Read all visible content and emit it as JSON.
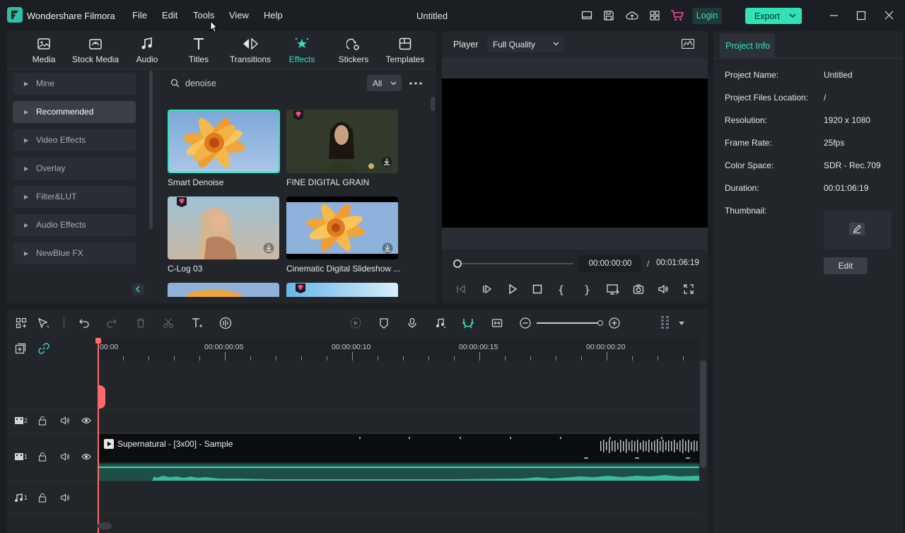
{
  "app": {
    "name": "Wondershare Filmora",
    "doc_title": "Untitled"
  },
  "menu": [
    "File",
    "Edit",
    "Tools",
    "View",
    "Help"
  ],
  "header": {
    "login": "Login",
    "export": "Export"
  },
  "media_tabs": [
    {
      "label": "Media",
      "icon": "media-icon"
    },
    {
      "label": "Stock Media",
      "icon": "stock-media-icon"
    },
    {
      "label": "Audio",
      "icon": "audio-note-icon"
    },
    {
      "label": "Titles",
      "icon": "titles-icon"
    },
    {
      "label": "Transitions",
      "icon": "transitions-icon"
    },
    {
      "label": "Effects",
      "icon": "effects-icon",
      "active": true
    },
    {
      "label": "Stickers",
      "icon": "stickers-icon"
    },
    {
      "label": "Templates",
      "icon": "templates-icon"
    }
  ],
  "categories": [
    {
      "label": "Mine"
    },
    {
      "label": "Recommended",
      "active": true
    },
    {
      "label": "Video Effects"
    },
    {
      "label": "Overlay"
    },
    {
      "label": "Filter&LUT"
    },
    {
      "label": "Audio Effects"
    },
    {
      "label": "NewBlue FX"
    }
  ],
  "search": {
    "value": "denoise",
    "filter": "All"
  },
  "effects": [
    {
      "label": "Smart Denoise",
      "selected": true
    },
    {
      "label": "FINE DIGITAL GRAIN",
      "premium": true
    },
    {
      "label": "C-Log 03",
      "premium": true
    },
    {
      "label": "Cinematic Digital Slideshow ..."
    }
  ],
  "player": {
    "label": "Player",
    "quality": "Full Quality",
    "current_time": "00:00:00:00",
    "separator": "/",
    "total_time": "00:01:06:19"
  },
  "project_info": {
    "tab": "Project Info",
    "rows": [
      {
        "label": "Project Name:",
        "value": "Untitled"
      },
      {
        "label": "Project Files Location:",
        "value": "/"
      },
      {
        "label": "Resolution:",
        "value": "1920 x 1080"
      },
      {
        "label": "Frame Rate:",
        "value": "25fps"
      },
      {
        "label": "Color Space:",
        "value": "SDR - Rec.709"
      },
      {
        "label": "Duration:",
        "value": "00:01:06:19"
      }
    ],
    "thumbnail_label": "Thumbnail:",
    "edit_label": "Edit"
  },
  "timeline": {
    "ruler": [
      "00:00",
      "00:00:00:05",
      "00:00:00:10",
      "00:00:00:15",
      "00:00:00:20"
    ],
    "clip_title": "Supernatural - [3x00] - Sample",
    "tracks": [
      {
        "num": "2"
      },
      {
        "num": "1"
      },
      {
        "num": "1"
      }
    ]
  },
  "colors": {
    "accent": "#36e0c0",
    "export_bg": "#2fe3b7",
    "login_bg": "#1e3a36",
    "premium": "#ff3d9a"
  }
}
